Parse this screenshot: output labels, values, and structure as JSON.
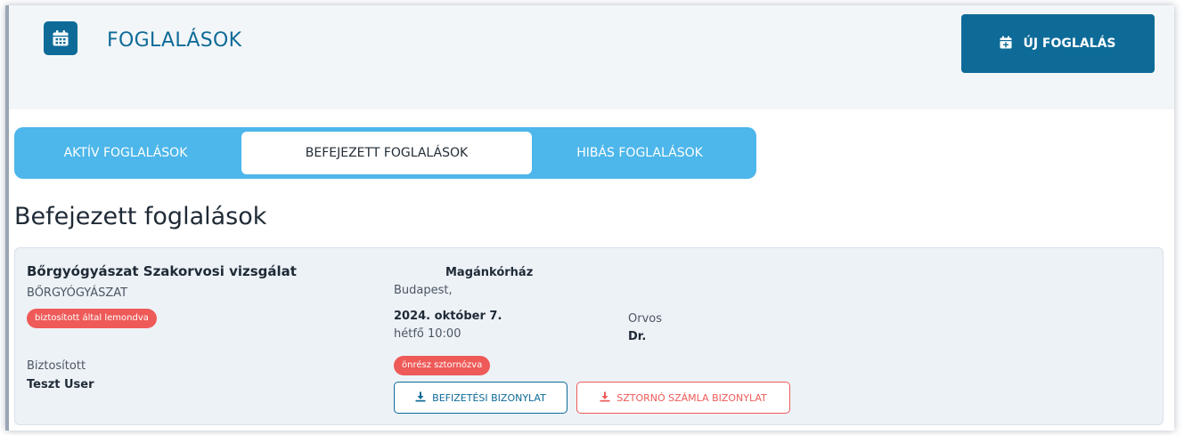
{
  "header": {
    "title": "FOGLALÁSOK",
    "icon": "calendar-icon",
    "new_button": {
      "label": "ÚJ FOGLALÁS",
      "icon": "calendar-plus-icon"
    }
  },
  "tabs": [
    {
      "label": "AKTÍV FOGLALÁSOK",
      "active": false
    },
    {
      "label": "BEFEJEZETT FOGLALÁSOK",
      "active": true
    },
    {
      "label": "HIBÁS FOGLALÁSOK",
      "active": false
    }
  ],
  "section_title": "Befejezett foglalások",
  "booking": {
    "service_name": "Bőrgyógyászat Szakorvosi vizsgálat",
    "specialty": "BŐRGYÓGYÁSZAT",
    "status_badge": "biztosított által lemondva",
    "insured_label": "Biztosított",
    "insured_name": "Teszt User",
    "facility_name": "Magánkórház",
    "facility_city": "Budapest,",
    "date": "2024. október 7.",
    "day_time": "hétfő 10:00",
    "doctor_label": "Orvos",
    "doctor_name": "Dr.",
    "payment_badge": "önrész sztornózva",
    "buttons": {
      "payment_receipt": "BEFIZETÉSI BIZONYLAT",
      "storno_receipt": "SZTORNÓ SZÁMLA BIZONYLAT"
    }
  },
  "colors": {
    "primary": "#0e6b98",
    "tab_bar": "#4db6ea",
    "danger": "#ee5a58",
    "card_bg": "#edf2f7",
    "header_bg": "#f3f6f9"
  }
}
